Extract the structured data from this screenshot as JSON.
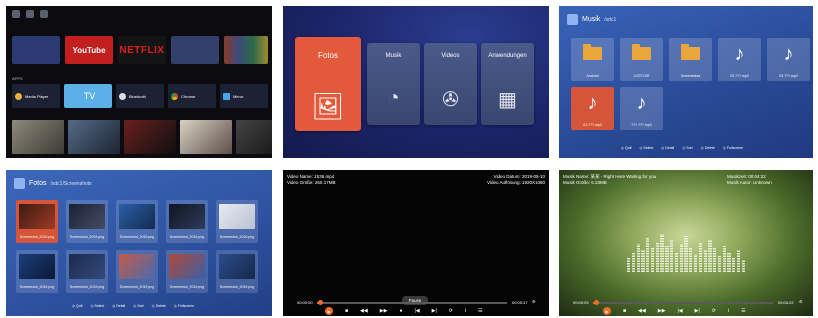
{
  "colors": {
    "accent_orange": "#e25a3b",
    "progress": "#f06b2a",
    "folder": "#e9a73b",
    "youtube": "#c21f1f",
    "netflix_text": "#e01e1e"
  },
  "launcher": {
    "apps_label": "APPS",
    "cards": [
      {
        "name": "youtube",
        "label": "YouTube"
      },
      {
        "name": "netflix",
        "label": "NETFLIX"
      }
    ],
    "sections": [
      {
        "name": "media-player",
        "icon": "play-icon",
        "label": "Media Player"
      },
      {
        "name": "tv",
        "icon": "tv-icon",
        "label": "TV"
      },
      {
        "name": "bluetooth",
        "icon": "bluetooth-icon",
        "label": "Bluetooth"
      },
      {
        "name": "chrome",
        "icon": "chrome-icon",
        "label": "Chrome"
      },
      {
        "name": "mirror",
        "icon": "cast-icon",
        "label": "Mirror"
      }
    ]
  },
  "main_menu": {
    "tiles": [
      {
        "label": "Fotos",
        "icon": "photo-icon"
      },
      {
        "label": "Musik",
        "icon": "music-disc-icon"
      },
      {
        "label": "Videos",
        "icon": "film-reel-icon"
      },
      {
        "label": "Anwendungen",
        "icon": "apps-icon"
      }
    ]
  },
  "music_browser": {
    "title": "Musik",
    "path": "/sdc1",
    "items": [
      {
        "type": "folder",
        "label": "Android"
      },
      {
        "type": "folder",
        "label": "LOST.DIR"
      },
      {
        "type": "folder",
        "label": "Screenshots"
      },
      {
        "type": "music",
        "label": "02.???.mp3"
      },
      {
        "type": "music",
        "label": "03.???.mp3"
      },
      {
        "type": "music",
        "label": "01.???.mp3"
      },
      {
        "type": "music",
        "label": "???.???.mp3"
      }
    ],
    "legend": [
      "Quit",
      "Select",
      "Detail",
      "Sort",
      "Delete",
      "Fullscreen"
    ]
  },
  "photo_browser": {
    "title": "Fotos",
    "path": "/sdc1/Screenshots",
    "items": [
      "Screenshot_2019.png",
      "Screenshot_2019.png",
      "Screenshot_2019.png",
      "Screenshot_2019.png",
      "Screenshot_2019.png",
      "Screenshot_2019.png",
      "Screenshot_2019.png",
      "Screenshot_2019.png",
      "Screenshot_2019.png",
      "Screenshot_2019.png"
    ],
    "legend": [
      "Quit",
      "Select",
      "Detail",
      "Sort",
      "Delete",
      "Fullscreen"
    ]
  },
  "video_player": {
    "name": "Video Name: 1536.mp4",
    "size": "Video Größe: 260.17MB",
    "date": "Video Datum: 2019-05-10",
    "resolution": "Video Auflösung: 1920X1080",
    "time_current": "00:00:00",
    "time_total": "00:05:37",
    "progress": 0.02,
    "pause_label": "Pause"
  },
  "music_player": {
    "name": "Musik Name: 某某 - Right Here Waiting for you",
    "size": "Musik Größe: 6.33MB",
    "length": "Musikzeit: 00:04:22",
    "artist": "Musik Autor: Unknown",
    "time_current": "00:00:03",
    "time_total": "00:04:22",
    "progress": 0.02,
    "eq_levels": [
      0.35,
      0.5,
      0.7,
      0.55,
      0.85,
      0.6,
      0.75,
      0.95,
      0.65,
      0.8,
      0.5,
      0.7,
      0.9,
      0.6,
      0.45,
      0.75,
      0.55,
      0.8,
      0.6,
      0.4,
      0.65,
      0.5,
      0.35,
      0.55,
      0.3
    ]
  }
}
